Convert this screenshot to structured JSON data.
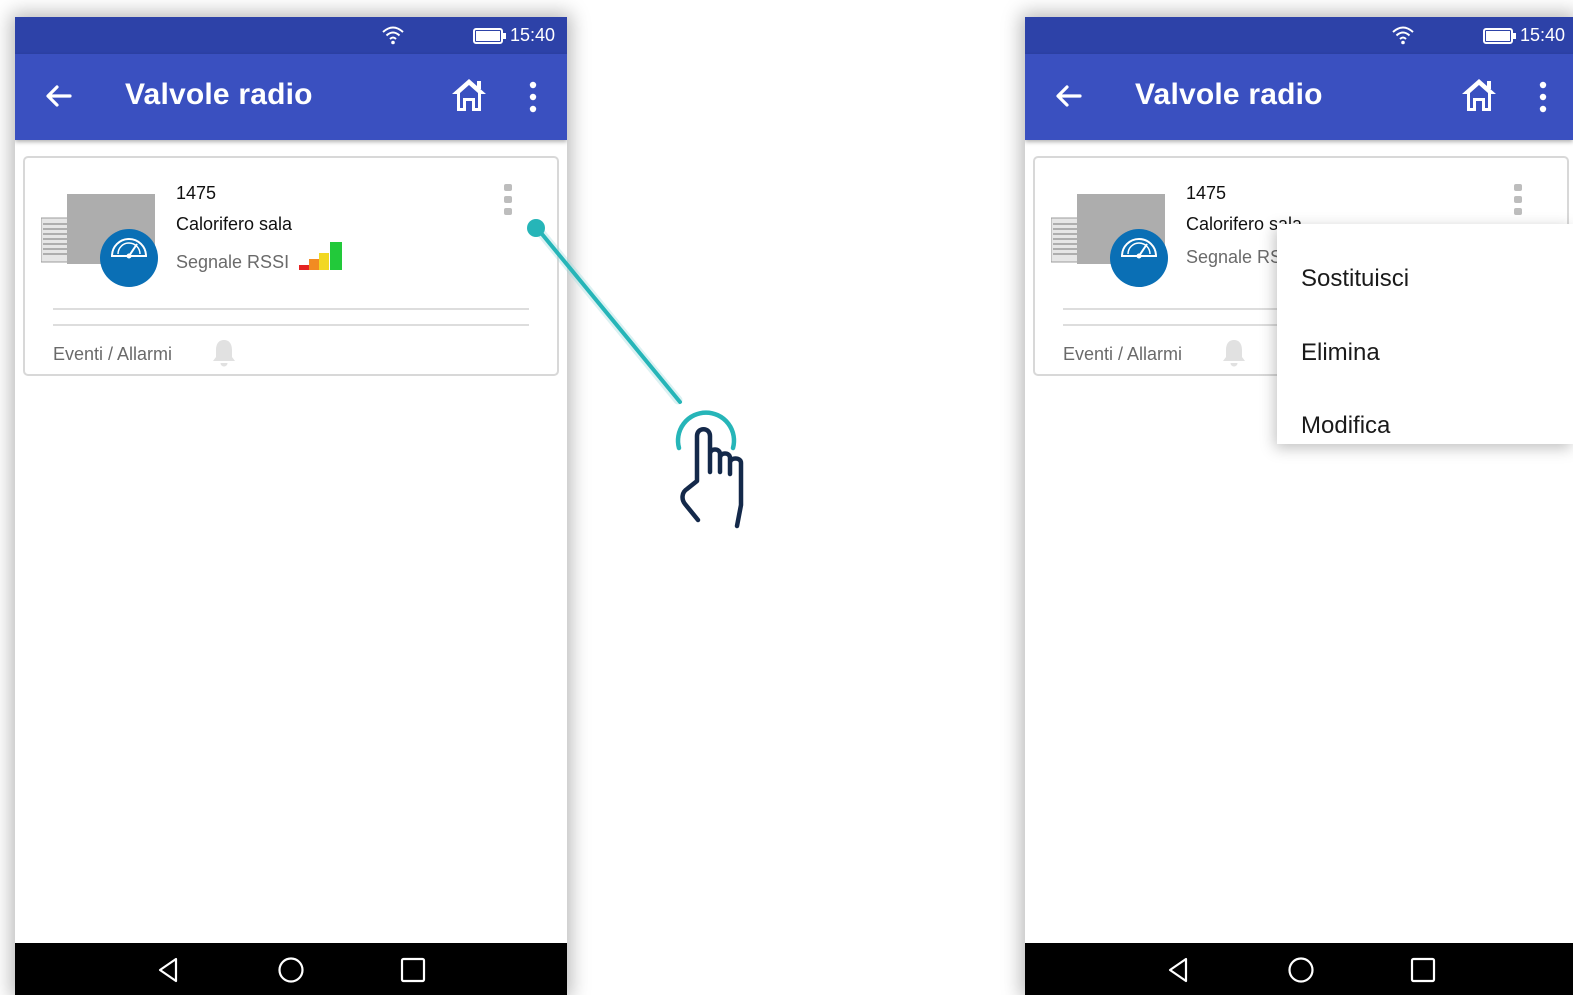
{
  "left_screen": {
    "status_bar": {
      "time": "15:40",
      "wifi_icon": "wifi-icon",
      "battery_icon": "battery-icon"
    },
    "app_bar": {
      "back_icon": "arrow-left-icon",
      "title": "Valvole radio",
      "home_icon": "home-icon",
      "overflow_icon": "more-vertical-icon"
    },
    "card": {
      "device_id": "1475",
      "device_name": "Calorifero sala",
      "rssi_label": "Segnale RSSI",
      "rssi_icon": "signal-bars-icon",
      "menu_icon": "more-vertical-icon",
      "events_label": "Eventi / Allarmi",
      "bell_icon": "bell-icon"
    },
    "nav_bar": {
      "back": "nav-back-icon",
      "home": "nav-home-icon",
      "recents": "nav-recents-icon"
    }
  },
  "gesture": {
    "icon": "tap-hand-icon",
    "accent_color": "#26b5b8"
  },
  "right_screen": {
    "status_bar": {
      "time": "15:40",
      "wifi_icon": "wifi-icon",
      "battery_icon": "battery-icon"
    },
    "app_bar": {
      "back_icon": "arrow-left-icon",
      "title": "Valvole radio",
      "home_icon": "home-icon",
      "overflow_icon": "more-vertical-icon"
    },
    "card": {
      "device_id": "1475",
      "device_name": "Calorifero sala",
      "rssi_label": "Segnale RSSI",
      "menu_icon": "more-vertical-icon",
      "events_label": "Eventi / Allarmi",
      "bell_icon": "bell-icon"
    },
    "popup_menu": {
      "items": [
        {
          "label": "Sostituisci"
        },
        {
          "label": "Elimina"
        },
        {
          "label": "Modifica"
        }
      ]
    },
    "nav_bar": {
      "back": "nav-back-icon",
      "home": "nav-home-icon",
      "recents": "nav-recents-icon"
    }
  },
  "colors": {
    "status_bar": "#2d42a8",
    "app_bar": "#3a50c0",
    "valve_badge": "#0a6fb5",
    "gesture_teal": "#26b5b8",
    "hand_navy": "#14294a"
  }
}
